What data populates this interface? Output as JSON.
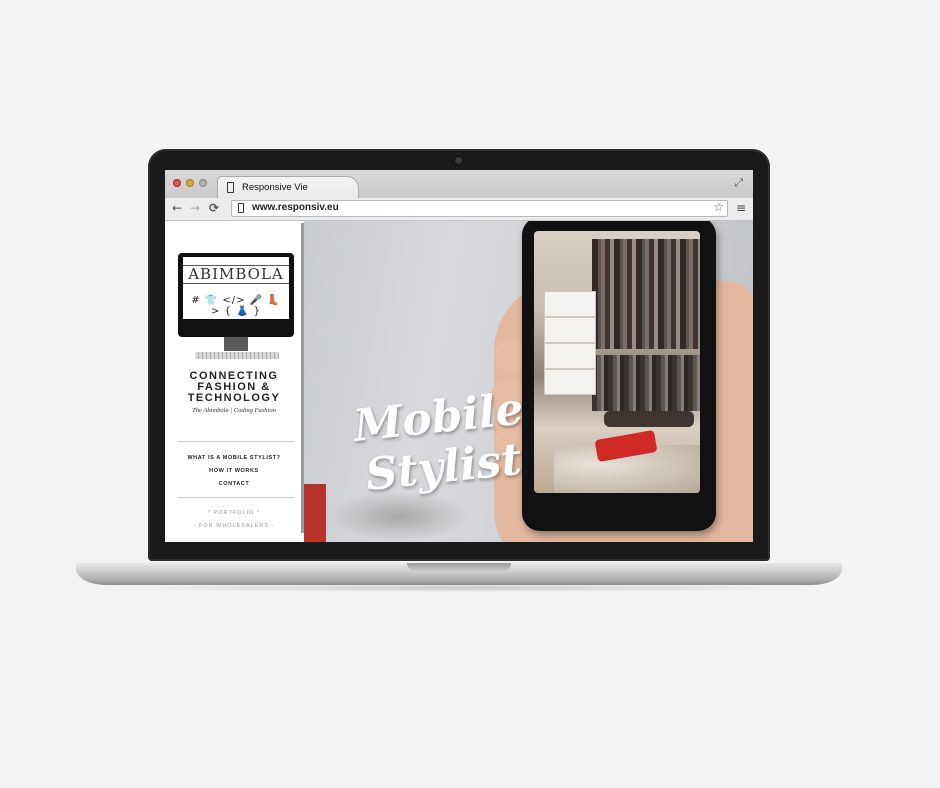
{
  "browser": {
    "tab_title": "Responsive Vie",
    "url": "www.responsiv.eu",
    "icons": {
      "back": "←",
      "forward": "→",
      "reload": "⟳",
      "bookmark": "☆",
      "menu": "≡",
      "expand": "⤢"
    }
  },
  "sidebar": {
    "logo_text": "ABIMBOLA",
    "logo_icons": "# 👕 </> 🎤 👢 > { 👗 }",
    "tagline_line1": "CONNECTING",
    "tagline_line2": "FASHION &",
    "tagline_line3": "TECHNOLOGY",
    "sub_tagline": "The Abimbola | Coding Fashion",
    "nav": [
      "WHAT IS A MOBILE STYLIST?",
      "HOW IT WORKS",
      "CONTACT"
    ],
    "secondary_nav": [
      "* PORTFOLIO *",
      "- FOR WHOLESALERS -"
    ]
  },
  "hero": {
    "title_line1": "Mobile",
    "title_line2": "Stylist"
  },
  "colors": {
    "accent_red": "#b9322a",
    "hero_bg": "#d2d4d7"
  }
}
